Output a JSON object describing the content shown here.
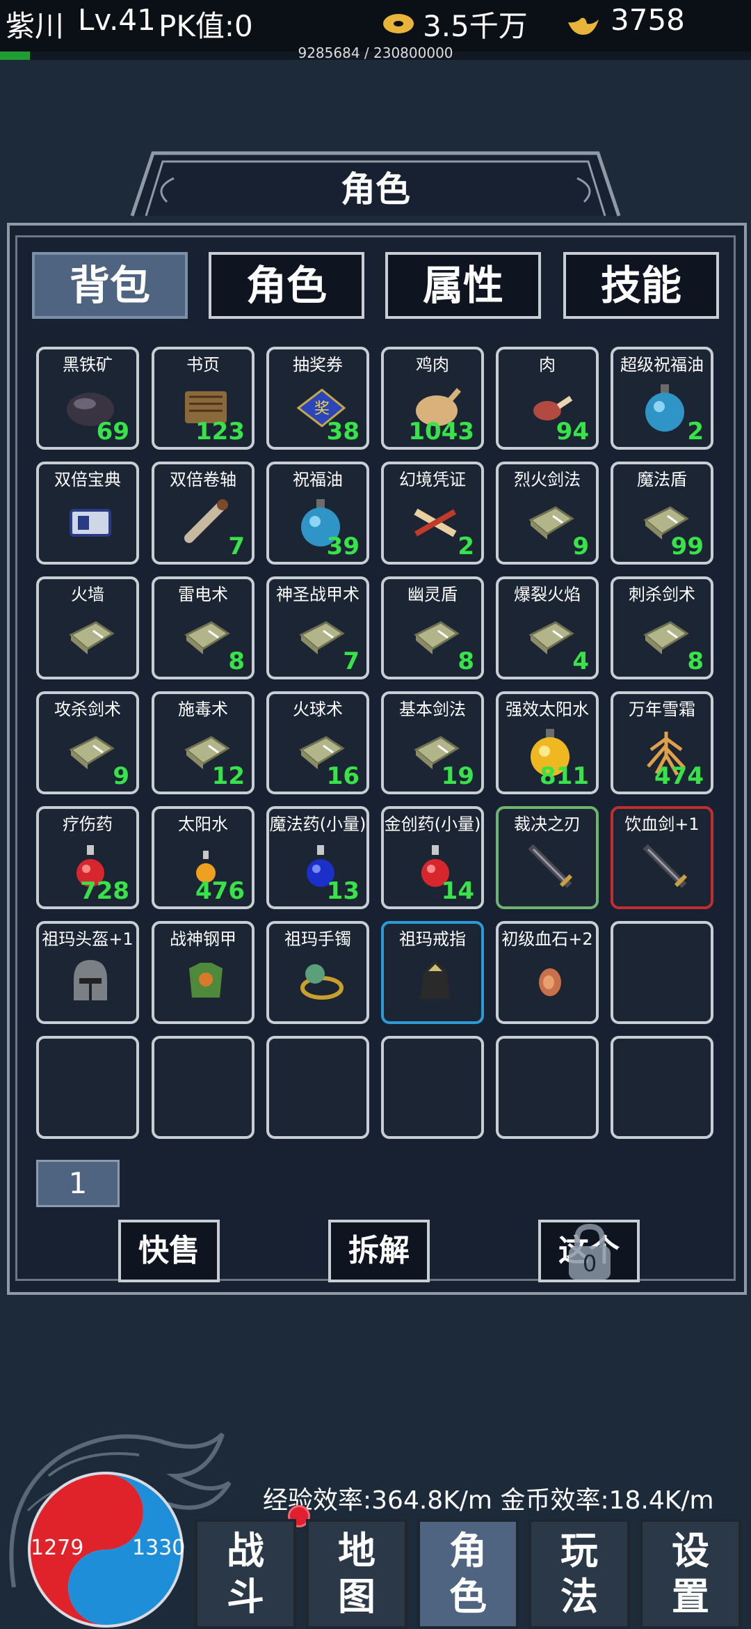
{
  "header": {
    "player_name": "紫川",
    "level": "Lv.41",
    "pk_value": "PK值:0",
    "gold_amount": "3.5千万",
    "ingot_amount": "3758",
    "exp_text": "9285684 / 230800000",
    "exp_fraction": 0.0402
  },
  "panel": {
    "title": "角色",
    "tabs": [
      "背包",
      "角色",
      "属性",
      "技能"
    ],
    "active_tab": 0
  },
  "inventory": {
    "items": [
      {
        "name": "黑铁矿",
        "count": "69",
        "icon": "iron-ore"
      },
      {
        "name": "书页",
        "count": "123",
        "icon": "book-page"
      },
      {
        "name": "抽奖券",
        "count": "38",
        "icon": "lottery-ticket"
      },
      {
        "name": "鸡肉",
        "count": "1043",
        "icon": "roast-chicken"
      },
      {
        "name": "肉",
        "count": "94",
        "icon": "meat"
      },
      {
        "name": "超级祝福油",
        "count": "2",
        "icon": "blessing-oil-flask"
      },
      {
        "name": "双倍宝典",
        "count": "",
        "icon": "double-book"
      },
      {
        "name": "双倍卷轴",
        "count": "7",
        "icon": "scroll"
      },
      {
        "name": "祝福油",
        "count": "39",
        "icon": "blessing-oil-flask"
      },
      {
        "name": "幻境凭证",
        "count": "2",
        "icon": "voucher-scroll"
      },
      {
        "name": "烈火剑法",
        "count": "9",
        "icon": "skill-book"
      },
      {
        "name": "魔法盾",
        "count": "99",
        "icon": "skill-book"
      },
      {
        "name": "火墙",
        "count": "",
        "icon": "skill-book"
      },
      {
        "name": "雷电术",
        "count": "8",
        "icon": "skill-book"
      },
      {
        "name": "神圣战甲术",
        "count": "7",
        "icon": "skill-book"
      },
      {
        "name": "幽灵盾",
        "count": "8",
        "icon": "skill-book"
      },
      {
        "name": "爆裂火焰",
        "count": "4",
        "icon": "skill-book"
      },
      {
        "name": "刺杀剑术",
        "count": "8",
        "icon": "skill-book"
      },
      {
        "name": "攻杀剑术",
        "count": "9",
        "icon": "skill-book"
      },
      {
        "name": "施毒术",
        "count": "12",
        "icon": "skill-book"
      },
      {
        "name": "火球术",
        "count": "16",
        "icon": "skill-book"
      },
      {
        "name": "基本剑法",
        "count": "19",
        "icon": "skill-book"
      },
      {
        "name": "强效太阳水",
        "count": "811",
        "icon": "sun-water-flask"
      },
      {
        "name": "万年雪霜",
        "count": "474",
        "icon": "ginseng"
      },
      {
        "name": "疗伤药",
        "count": "728",
        "icon": "red-potion"
      },
      {
        "name": "太阳水",
        "count": "476",
        "icon": "small-yellow-potion"
      },
      {
        "name": "魔法药(小量)",
        "count": "13",
        "icon": "blue-potion"
      },
      {
        "name": "金创药(小量)",
        "count": "14",
        "icon": "red-potion"
      },
      {
        "name": "裁决之刃",
        "count": "",
        "icon": "sword",
        "rarity": "green"
      },
      {
        "name": "饮血剑+1",
        "count": "",
        "icon": "sword",
        "rarity": "red"
      },
      {
        "name": "祖玛头盔+1",
        "count": "",
        "icon": "helmet"
      },
      {
        "name": "战神钢甲",
        "count": "",
        "icon": "armor"
      },
      {
        "name": "祖玛手镯",
        "count": "",
        "icon": "bracelet"
      },
      {
        "name": "祖玛戒指",
        "count": "",
        "icon": "ring",
        "rarity": "blue"
      },
      {
        "name": "初级血石+2",
        "count": "",
        "icon": "blood-stone"
      },
      {
        "name": "",
        "count": "",
        "icon": ""
      },
      {
        "name": "",
        "count": "",
        "icon": ""
      },
      {
        "name": "",
        "count": "",
        "icon": ""
      },
      {
        "name": "",
        "count": "",
        "icon": ""
      },
      {
        "name": "",
        "count": "",
        "icon": ""
      },
      {
        "name": "",
        "count": "",
        "icon": ""
      },
      {
        "name": "",
        "count": "",
        "icon": ""
      }
    ],
    "page": "1"
  },
  "actions": {
    "quick_sell": "快售",
    "dismantle": "拆解",
    "third_button": "这个",
    "lock_badge": "0"
  },
  "footer": {
    "rates": "经验效率:364.8K/m 金币效率:18.4K/m",
    "hp": "1279",
    "mp": "1330",
    "nav": [
      {
        "label": "战斗",
        "active": false
      },
      {
        "label": "地图",
        "active": false
      },
      {
        "label": "角色",
        "active": true
      },
      {
        "label": "玩法",
        "active": false
      },
      {
        "label": "设置",
        "active": false
      }
    ]
  },
  "colors": {
    "background": "#1d2a3a",
    "count_green": "#38e34a",
    "active_tab": "#4e6480",
    "hp_red": "#e0222b",
    "mp_blue": "#1f8ed8"
  }
}
